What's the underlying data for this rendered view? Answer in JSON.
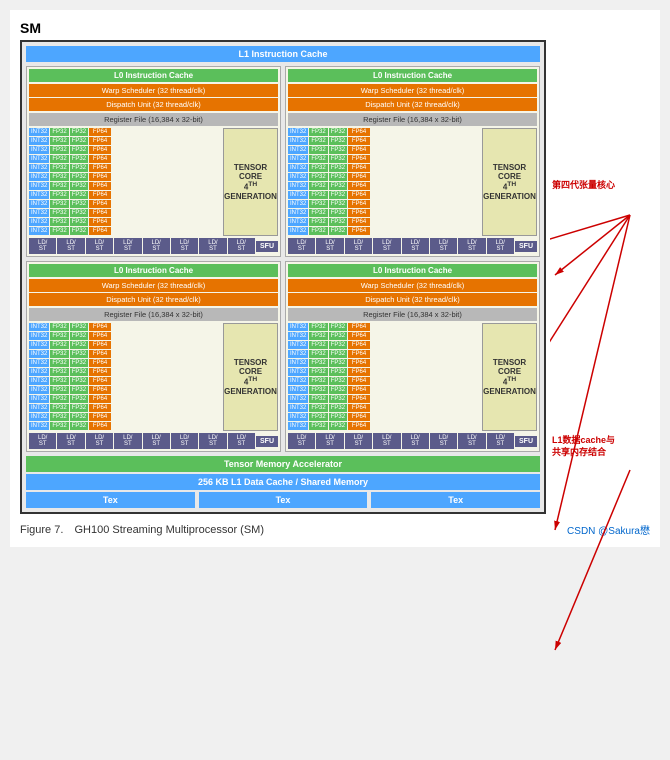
{
  "title": "SM",
  "figure_label": "Figure 7.",
  "figure_caption": "GH100 Streaming Multiprocessor (SM)",
  "figure_source": "CSDN @Sakura懋",
  "l1_instruction_cache": "L1 Instruction Cache",
  "l0_instruction_cache": "L0 Instruction Cache",
  "warp_scheduler": "Warp Scheduler (32 thread/clk)",
  "dispatch_unit": "Dispatch Unit (32 thread/clk)",
  "register_file": "Register File (16,384 x 32-bit)",
  "tensor_core_label": "TENSOR CORE",
  "tensor_core_gen": "4TH GENERATION",
  "sfu_label": "SFU",
  "tensor_memory_accelerator": "Tensor Memory Accelerator",
  "l1_data_cache": "256 KB L1 Data Cache / Shared Memory",
  "tex_label": "Tex",
  "annotation1": "第四代张量核心",
  "annotation2": "L1数据cache与\n共享内存结合",
  "colors": {
    "blue": "#4da6ff",
    "green": "#5bbf5b",
    "orange": "#e67300",
    "gray": "#b8b8b8",
    "purple": "#5b5b8a",
    "yellow_bg": "#e6e6b0"
  },
  "grid_rows": [
    {
      "int32": "INT32",
      "fp32a": "FP32",
      "fp32b": "FP32",
      "fp64": "FP64"
    },
    {
      "int32": "INT32",
      "fp32a": "FP32",
      "fp32b": "FP32",
      "fp64": "FP64"
    },
    {
      "int32": "INT32",
      "fp32a": "FP32",
      "fp32b": "FP32",
      "fp64": "FP64"
    },
    {
      "int32": "INT32",
      "fp32a": "FP32",
      "fp32b": "FP32",
      "fp64": "FP64"
    },
    {
      "int32": "INT32",
      "fp32a": "FP32",
      "fp32b": "FP32",
      "fp64": "FP64"
    },
    {
      "int32": "INT32",
      "fp32a": "FP32",
      "fp32b": "FP32",
      "fp64": "FP64"
    },
    {
      "int32": "INT32",
      "fp32a": "FP32",
      "fp32b": "FP32",
      "fp64": "FP64"
    },
    {
      "int32": "INT32",
      "fp32a": "FP32",
      "fp32b": "FP32",
      "fp64": "FP64"
    },
    {
      "int32": "INT32",
      "fp32a": "FP32",
      "fp32b": "FP32",
      "fp64": "FP64"
    },
    {
      "int32": "INT32",
      "fp32a": "FP32",
      "fp32b": "FP32",
      "fp64": "FP64"
    },
    {
      "int32": "INT32",
      "fp32a": "FP32",
      "fp32b": "FP32",
      "fp64": "FP64"
    },
    {
      "int32": "INT32",
      "fp32a": "FP32",
      "fp32b": "FP32",
      "fp64": "FP64"
    }
  ],
  "ld_st_cells": [
    "LD/ST",
    "LD/ST",
    "LD/ST",
    "LD/ST",
    "LD/ST",
    "LD/ST",
    "LD/ST",
    "LD/ST"
  ]
}
